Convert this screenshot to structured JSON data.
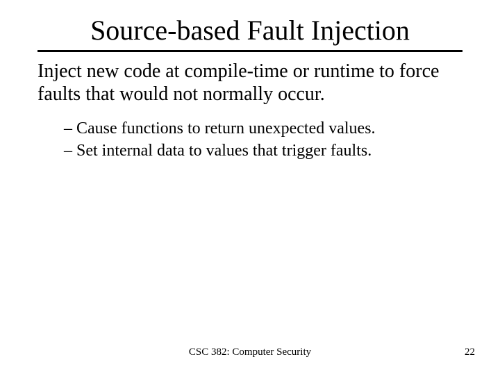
{
  "title": "Source-based Fault Injection",
  "body_text": "Inject new code at compile-time or runtime to force faults that would not normally occur.",
  "sub_items": [
    "– Cause functions to return unexpected values.",
    "– Set internal data to values that trigger faults."
  ],
  "footer": {
    "course": "CSC 382: Computer Security",
    "page": "22"
  }
}
